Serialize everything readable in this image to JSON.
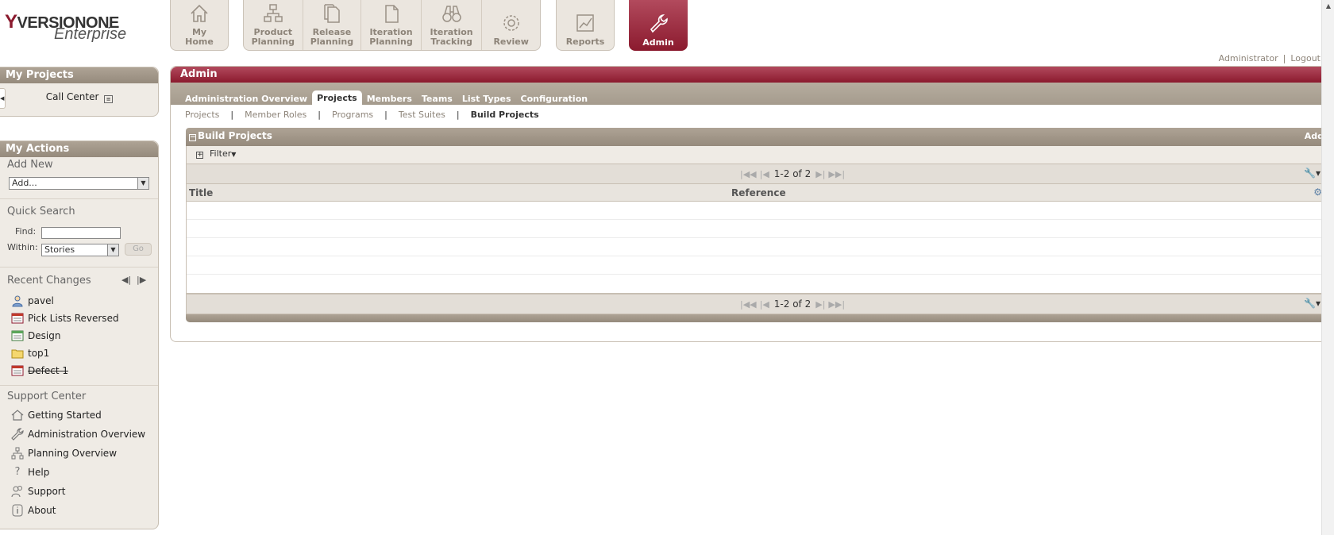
{
  "logo": {
    "brand": "VERSIONONE",
    "edition": "Enterprise"
  },
  "nav": {
    "group1": [
      {
        "label": "My Home",
        "icon": "house-icon"
      }
    ],
    "group2": [
      {
        "label": "Product Planning",
        "icon": "hierarchy-icon"
      },
      {
        "label": "Release Planning",
        "icon": "documents-icon"
      },
      {
        "label": "Iteration Planning",
        "icon": "document-icon"
      },
      {
        "label": "Iteration Tracking",
        "icon": "binoculars-icon"
      },
      {
        "label": "Review",
        "icon": "gear-icon"
      }
    ],
    "group3": [
      {
        "label": "Reports",
        "icon": "chart-icon"
      }
    ],
    "admin": {
      "label": "Admin",
      "icon": "wrench-icon"
    }
  },
  "userbar": {
    "user": "Administrator",
    "separator": "|",
    "logout": "Logout"
  },
  "sidebar": {
    "my_projects": {
      "title": "My Projects",
      "project": "Call Center"
    },
    "my_actions": {
      "title": "My Actions",
      "add_new": {
        "heading": "Add New",
        "selected": "Add..."
      },
      "quick_search": {
        "heading": "Quick Search",
        "find_label": "Find:",
        "find_value": "",
        "within_label": "Within:",
        "within_selected": "Stories",
        "go": "Go"
      },
      "recent_changes": {
        "heading": "Recent Changes",
        "items": [
          {
            "label": "pavel",
            "icon": "user-icon"
          },
          {
            "label": "Pick Lists Reversed",
            "icon": "calendar-icon"
          },
          {
            "label": "Design",
            "icon": "board-icon"
          },
          {
            "label": "top1",
            "icon": "folder-icon"
          },
          {
            "label": "Defect 1",
            "icon": "calendar-icon"
          }
        ]
      },
      "support_center": {
        "heading": "Support Center",
        "items": [
          {
            "label": "Getting Started",
            "icon": "house-icon"
          },
          {
            "label": "Administration Overview",
            "icon": "wrench-icon"
          },
          {
            "label": "Planning Overview",
            "icon": "hierarchy-icon"
          },
          {
            "label": "Help",
            "icon": "question-icon"
          },
          {
            "label": "Support",
            "icon": "people-icon"
          },
          {
            "label": "About",
            "icon": "info-icon"
          }
        ]
      }
    }
  },
  "main": {
    "title": "Admin",
    "tabs": [
      "Administration Overview",
      "Projects",
      "Members",
      "Teams",
      "List Types",
      "Configuration"
    ],
    "active_tab": "Projects",
    "subtabs": [
      "Projects",
      "Member Roles",
      "Programs",
      "Test Suites",
      "Build Projects"
    ],
    "active_subtab": "Build Projects",
    "grid": {
      "title": "Build Projects",
      "add": "Add",
      "filter": "Filter",
      "pager_text": "1-2 of 2",
      "columns": [
        "Title",
        "Reference"
      ],
      "rows": [
        {
          "title": "",
          "reference": ""
        },
        {
          "title": "",
          "reference": ""
        },
        {
          "title": "",
          "reference": ""
        },
        {
          "title": "",
          "reference": ""
        },
        {
          "title": "",
          "reference": ""
        }
      ]
    }
  },
  "colors": {
    "accent": "#8b1a2e",
    "panel_header": "#a59b8d",
    "panel_bg": "#efebe5"
  }
}
